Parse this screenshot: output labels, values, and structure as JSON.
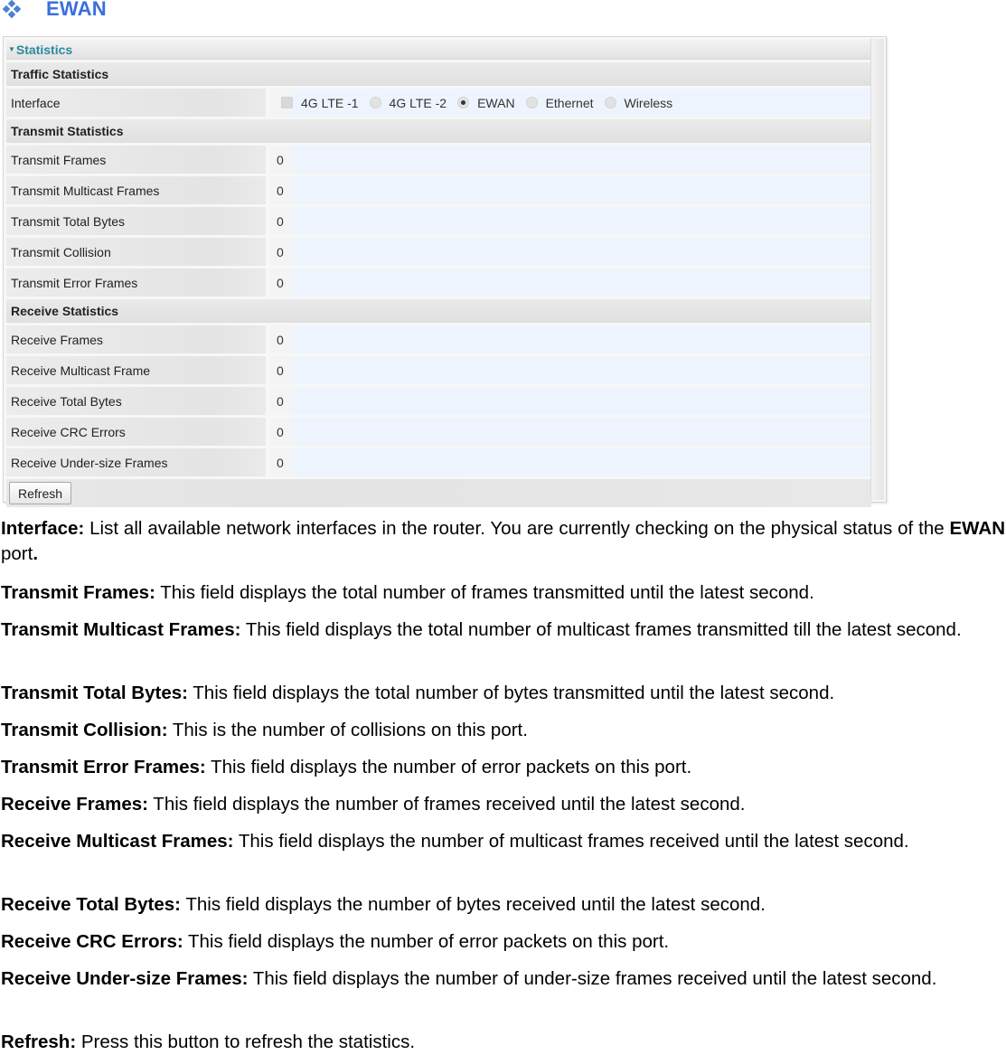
{
  "heading": {
    "icon": "diamond-bullet-icon",
    "title": "EWAN"
  },
  "panel": {
    "title": "Statistics",
    "collapse_icon": "caret-down-icon",
    "traffic_section": "Traffic Statistics",
    "interface_label": "Interface",
    "interfaces": [
      {
        "label": "4G LTE -1",
        "selected": false
      },
      {
        "label": "4G LTE -2",
        "selected": false
      },
      {
        "label": "EWAN",
        "selected": true
      },
      {
        "label": "Ethernet",
        "selected": false
      },
      {
        "label": "Wireless",
        "selected": false
      }
    ],
    "transmit_section": "Transmit Statistics",
    "transmit_rows": [
      {
        "label": "Transmit Frames",
        "value": "0"
      },
      {
        "label": "Transmit Multicast Frames",
        "value": "0"
      },
      {
        "label": "Transmit Total Bytes",
        "value": "0"
      },
      {
        "label": "Transmit Collision",
        "value": "0"
      },
      {
        "label": "Transmit Error Frames",
        "value": "0"
      }
    ],
    "receive_section": "Receive Statistics",
    "receive_rows": [
      {
        "label": "Receive Frames",
        "value": "0"
      },
      {
        "label": "Receive Multicast Frame",
        "value": "0"
      },
      {
        "label": "Receive Total Bytes",
        "value": "0"
      },
      {
        "label": "Receive CRC Errors",
        "value": "0"
      },
      {
        "label": "Receive Under-size Frames",
        "value": "0"
      }
    ],
    "refresh_label": "Refresh"
  },
  "descriptions": [
    {
      "term": "Interface:",
      "text": " List all available network interfaces in the router.  You are currently checking on the physical status of the ",
      "term2": "EWAN",
      "text2": " port",
      "end": "."
    },
    {
      "term": "Transmit Frames:",
      "text": " This field displays the total number of frames transmitted until the latest second."
    },
    {
      "term": "Transmit Multicast Frames:",
      "text": " This field displays the total number of multicast frames transmitted till the latest second."
    },
    {
      "term": "Transmit Total Bytes:",
      "text": " This field displays the total number of bytes transmitted until the latest second."
    },
    {
      "term": "Transmit Collision:",
      "text": " This is the number of collisions on this port."
    },
    {
      "term": "Transmit Error Frames:",
      "text": " This field displays the number of error packets on this port."
    },
    {
      "term": "Receive Frames:",
      "text": " This field displays the number of frames received until the latest second."
    },
    {
      "term": "Receive Multicast Frames:",
      "text": " This field displays the number of multicast frames received until the latest second."
    },
    {
      "term": "Receive Total Bytes:",
      "text": " This field displays the number of bytes received until the latest second."
    },
    {
      "term": "Receive CRC Errors:",
      "text": " This field displays the number of error packets on this port."
    },
    {
      "term": "Receive Under-size Frames:",
      "text": " This field displays the number of under-size frames received until the latest second."
    },
    {
      "term": "Refresh:",
      "text": " Press this button to refresh the statistics."
    }
  ]
}
